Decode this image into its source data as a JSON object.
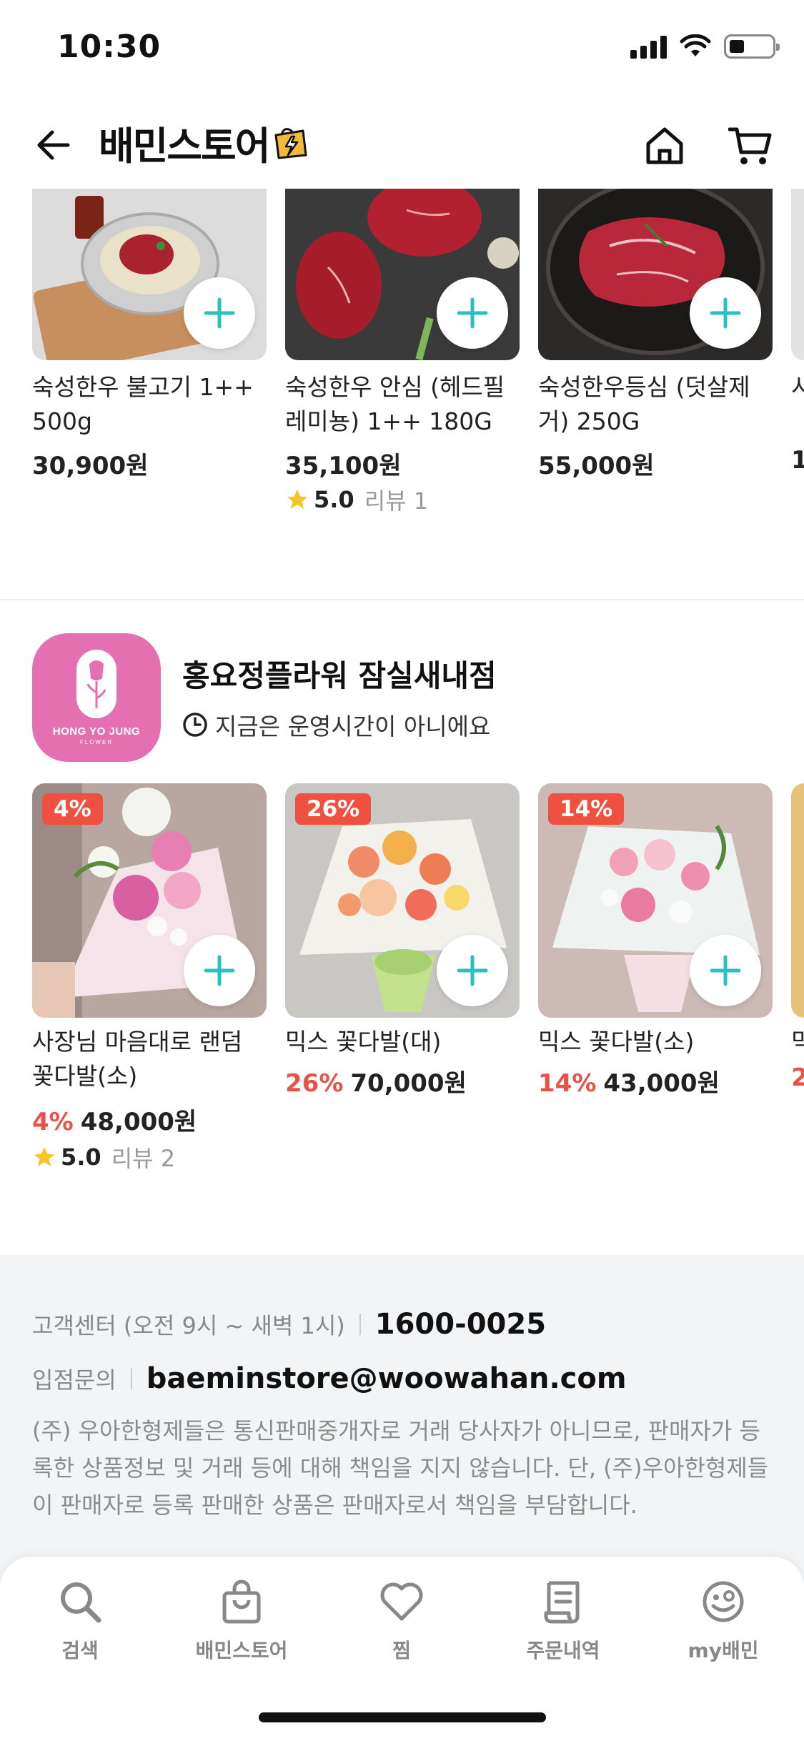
{
  "status_bar": {
    "time": "10:30"
  },
  "header": {
    "title": "배민스토어"
  },
  "product_row_1": [
    {
      "name": "숙성한우 불고기 1++ 500g",
      "price": "30,900원"
    },
    {
      "name": "숙성한우 안심 (헤드필레미뇽) 1++ 180G",
      "price": "35,100원",
      "rating": "5.0",
      "review": "리뷰 1"
    },
    {
      "name": "숙성한우등심 (덧살제거) 250G",
      "price": "55,000원"
    },
    {
      "name": "시",
      "price": "1"
    }
  ],
  "store": {
    "logo_title": "HONG YO JUNG",
    "logo_sub": "FLOWER",
    "name": "홍요정플라워 잠실새내점",
    "status": "지금은 운영시간이 아니에요"
  },
  "product_row_2": [
    {
      "badge": "4%",
      "name": "사장님 마음대로 랜덤 꽃다발(소)",
      "discount": "4%",
      "price": "48,000원",
      "rating": "5.0",
      "review": "리뷰 2"
    },
    {
      "badge": "26%",
      "name": "믹스 꽃다발(대)",
      "discount": "26%",
      "price": "70,000원"
    },
    {
      "badge": "14%",
      "name": "믹스 꽃다발(소)",
      "discount": "14%",
      "price": "43,000원"
    },
    {
      "name": "믹",
      "discount": "2"
    }
  ],
  "footer": {
    "cs_label": "고객센터 (오전 9시 ~ 새벽 1시)",
    "cs_phone": "1600-0025",
    "inquiry_label": "입점문의",
    "inquiry_email": "baeminstore@woowahan.com",
    "disclaimer": "(주) 우아한형제들은 통신판매중개자로 거래 당사자가 아니므로, 판매자가 등록한 상품정보 및 거래 등에 대해 책임을 지지 않습니다. 단, (주)우아한형제들이 판매자로 등록 판매한 상품은 판매자로서 책임을 부담합니다."
  },
  "tabbar": [
    {
      "label": "검색",
      "icon": "search-icon"
    },
    {
      "label": "배민스토어",
      "icon": "shopping-bag-icon"
    },
    {
      "label": "찜",
      "icon": "heart-icon"
    },
    {
      "label": "주문내역",
      "icon": "receipt-icon"
    },
    {
      "label": "my배민",
      "icon": "smiley-icon"
    }
  ],
  "colors": {
    "accent_mint": "#2ac1bc",
    "discount_red": "#ea5249",
    "badge_red": "#f0503f",
    "store_pink": "#e46fb1",
    "star": "#f7c325"
  }
}
